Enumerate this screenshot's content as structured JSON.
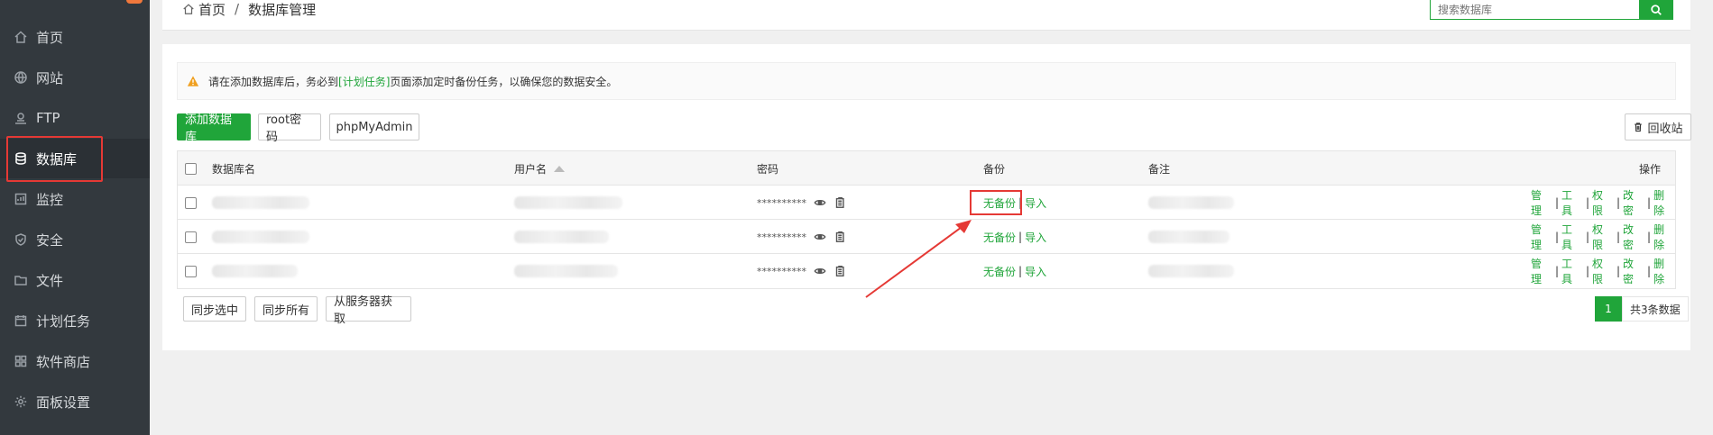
{
  "sidebar": {
    "items": [
      {
        "label": "首页",
        "icon": "home-icon"
      },
      {
        "label": "网站",
        "icon": "globe-icon"
      },
      {
        "label": "FTP",
        "icon": "ftp-icon"
      },
      {
        "label": "数据库",
        "icon": "database-icon"
      },
      {
        "label": "监控",
        "icon": "monitor-icon"
      },
      {
        "label": "安全",
        "icon": "shield-icon"
      },
      {
        "label": "文件",
        "icon": "folder-icon"
      },
      {
        "label": "计划任务",
        "icon": "calendar-icon"
      },
      {
        "label": "软件商店",
        "icon": "apps-icon"
      },
      {
        "label": "面板设置",
        "icon": "gear-icon"
      }
    ]
  },
  "breadcrumb": {
    "home": "首页",
    "separator": "/",
    "current": "数据库管理"
  },
  "search": {
    "placeholder": "搜索数据库"
  },
  "notice": {
    "text_before": "请在添加数据库后，务必到",
    "link": "[计划任务]",
    "text_after": "页面添加定时备份任务，以确保您的数据安全。"
  },
  "toolbar": {
    "add_label": "添加数据库",
    "root_label": "root密码",
    "pma_label": "phpMyAdmin",
    "recycle_label": "回收站"
  },
  "table": {
    "headers": {
      "name": "数据库名",
      "user": "用户名",
      "password": "密码",
      "backup": "备份",
      "note": "备注",
      "actions": "操作"
    },
    "rows": [
      {
        "password": "**********",
        "backup": "无备份",
        "import": "导入"
      },
      {
        "password": "**********",
        "backup": "无备份",
        "import": "导入"
      },
      {
        "password": "**********",
        "backup": "无备份",
        "import": "导入"
      }
    ],
    "actions": {
      "manage": "管理",
      "tools": "工具",
      "perms": "权限",
      "changepw": "改密",
      "delete": "删除",
      "sep": "|"
    }
  },
  "bottom": {
    "sync_selected": "同步选中",
    "sync_all": "同步所有",
    "fetch_server": "从服务器获取"
  },
  "pager": {
    "page": "1",
    "total": "共3条数据"
  },
  "colors": {
    "accent": "#20a53a",
    "highlight": "#e53935",
    "sidebar": "#33393e"
  }
}
